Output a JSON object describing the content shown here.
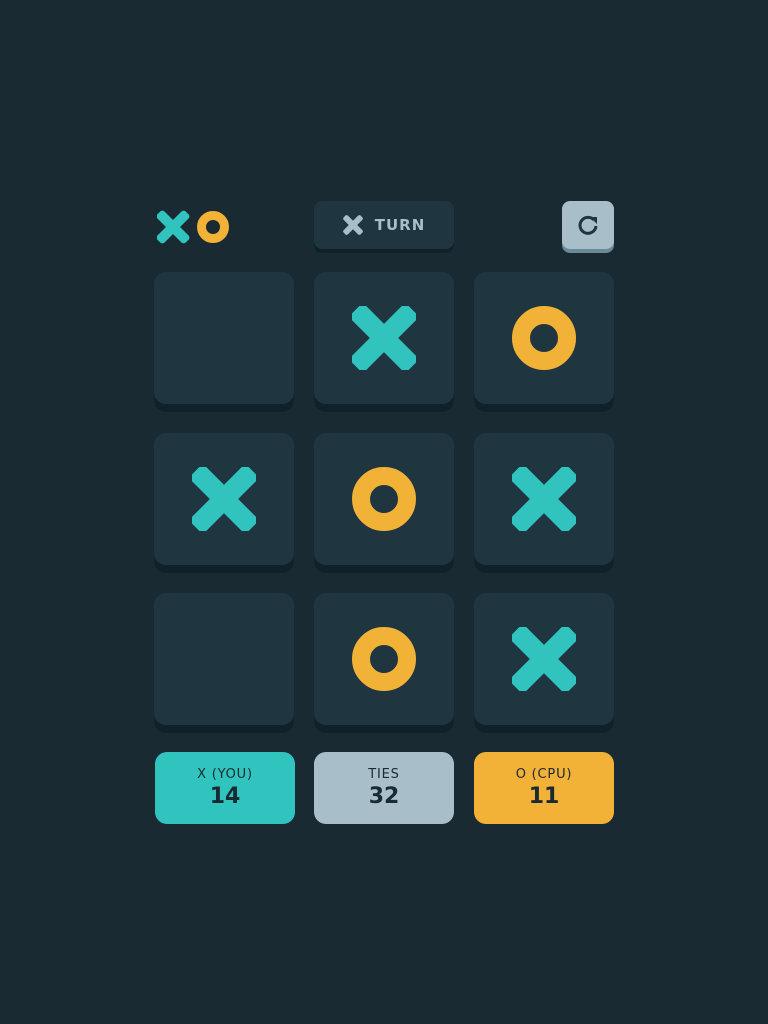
{
  "header": {
    "logo": [
      "x-icon",
      "o-icon"
    ],
    "turn": {
      "mark": "X",
      "label": "TURN"
    },
    "restart_icon": "restart-icon"
  },
  "board": [
    [
      "",
      "X",
      "O"
    ],
    [
      "X",
      "O",
      "X"
    ],
    [
      "",
      "O",
      "X"
    ]
  ],
  "scores": [
    {
      "label": "X (YOU)",
      "value": "14",
      "color": "#31c3bd"
    },
    {
      "label": "TIES",
      "value": "32",
      "color": "#a8bfc9"
    },
    {
      "label": "O (CPU)",
      "value": "11",
      "color": "#f2b137"
    }
  ],
  "colors": {
    "x": "#31c3bd",
    "o": "#f2b137",
    "background": "#1a2a33",
    "cell": "#1f3641",
    "silver": "#a8bfc9"
  }
}
